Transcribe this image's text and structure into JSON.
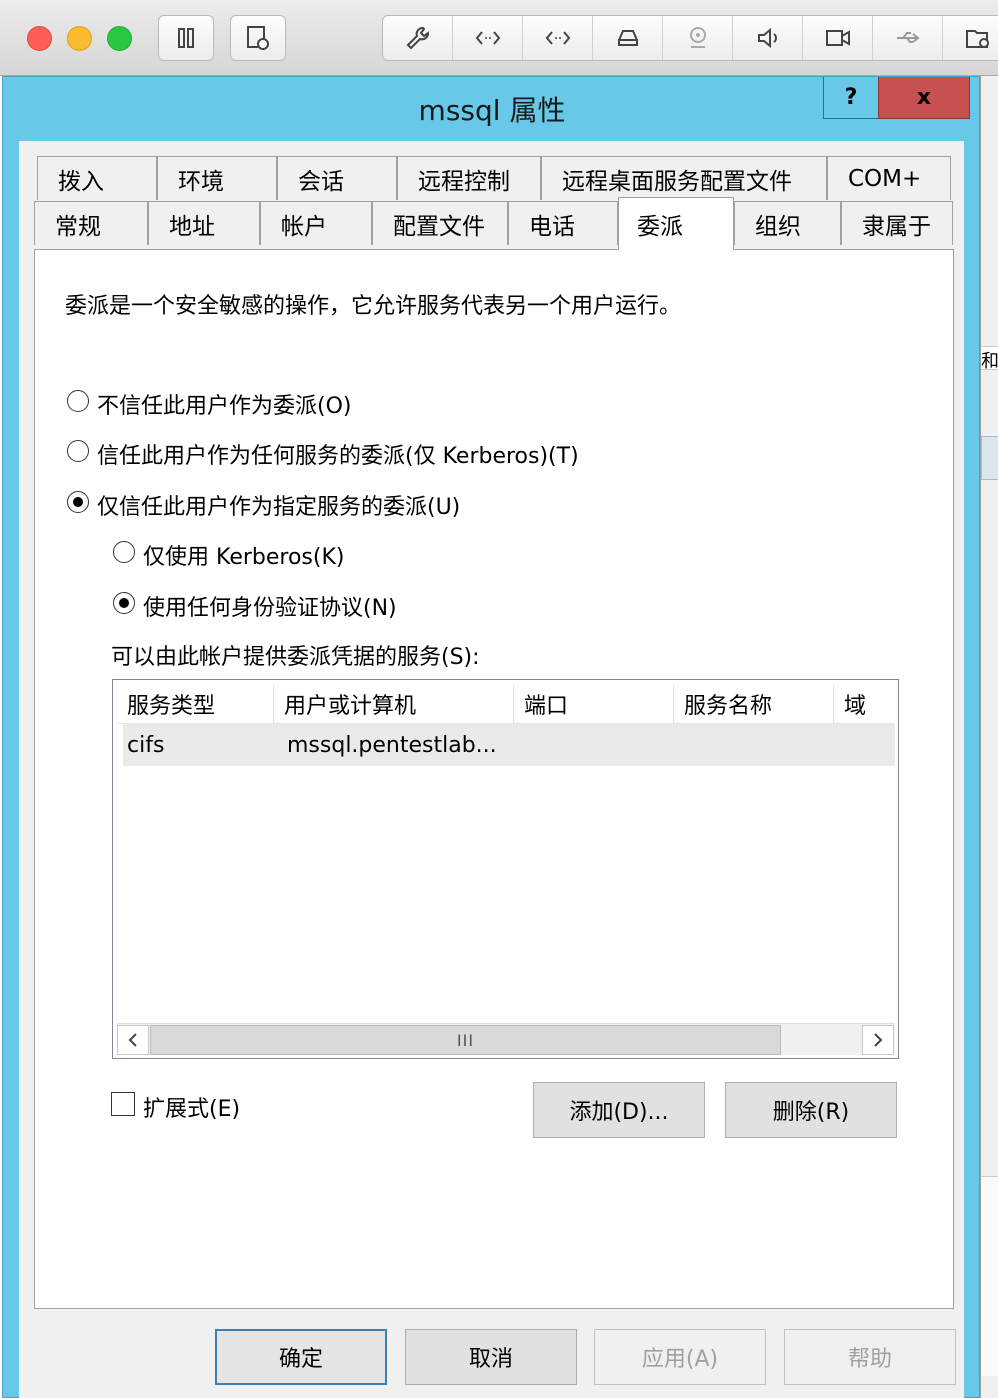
{
  "toolbar": {
    "icons": [
      "pause-icon",
      "snapshot-icon",
      "wrench-icon",
      "code-icon",
      "code-alt-icon",
      "hard-drive-icon",
      "webcam-icon",
      "speaker-icon",
      "video-camera-icon",
      "usb-icon",
      "shared-folder-icon"
    ]
  },
  "dialog": {
    "title": "mssql 属性",
    "help_label": "?",
    "close_label": "x"
  },
  "tabs": {
    "row1": [
      "拨入",
      "环境",
      "会话",
      "远程控制",
      "远程桌面服务配置文件",
      "COM+"
    ],
    "row2": [
      "常规",
      "地址",
      "帐户",
      "配置文件",
      "电话",
      "委派",
      "组织",
      "隶属于"
    ],
    "active": "委派"
  },
  "delegation": {
    "description": "委派是一个安全敏感的操作，它允许服务代表另一个用户运行。",
    "options": [
      {
        "label": "不信任此用户作为委派(O)",
        "selected": false
      },
      {
        "label": "信任此用户作为任何服务的委派(仅 Kerberos)(T)",
        "selected": false
      },
      {
        "label": "仅信任此用户作为指定服务的委派(U)",
        "selected": true
      }
    ],
    "sub_options": [
      {
        "label": "仅使用 Kerberos(K)",
        "selected": false
      },
      {
        "label": "使用任何身份验证协议(N)",
        "selected": true
      }
    ],
    "services_label": "可以由此帐户提供委派凭据的服务(S):",
    "columns": [
      "服务类型",
      "用户或计算机",
      "端口",
      "服务名称",
      "域"
    ],
    "rows": [
      {
        "service_type": "cifs",
        "user_or_computer": "mssql.pentestlab...",
        "port": "",
        "service_name": "",
        "domain": ""
      }
    ],
    "scroll_grip": "III",
    "expanded_label": "扩展式(E)",
    "expanded_checked": false,
    "add_label": "添加(D)...",
    "remove_label": "删除(R)"
  },
  "footer": {
    "ok_label": "确定",
    "cancel_label": "取消",
    "apply_label": "应用(A)",
    "help_label": "帮助"
  },
  "background_window": {
    "visible_text": "和"
  },
  "colors": {
    "title_bar": "#68c8e8",
    "close_button": "#c75050",
    "default_button_border": "#3c7fb1"
  }
}
